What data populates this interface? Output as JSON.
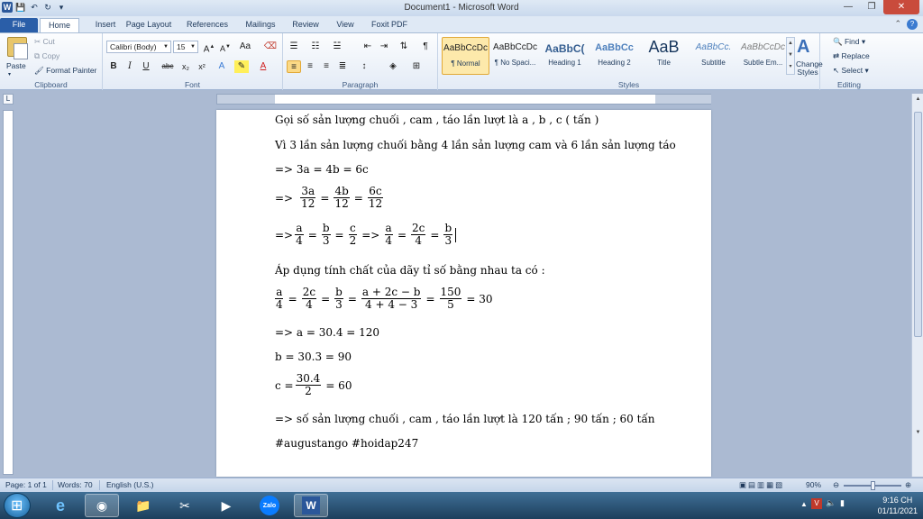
{
  "window": {
    "title": "Document1 - Microsoft Word",
    "min": "—",
    "max": "❐",
    "close": "✕"
  },
  "tabs": [
    "File",
    "Home",
    "Insert",
    "Page Layout",
    "References",
    "Mailings",
    "Review",
    "View",
    "Foxit PDF"
  ],
  "clipboard": {
    "label": "Clipboard",
    "paste": "Paste",
    "cut": "Cut",
    "copy": "Copy",
    "format_painter": "Format Painter"
  },
  "font": {
    "label": "Font",
    "name": "Calibri (Body)",
    "size": "15"
  },
  "paragraph": {
    "label": "Paragraph"
  },
  "styles": {
    "label": "Styles",
    "items": [
      {
        "preview": "AaBbCcDc",
        "name": "¶ Normal"
      },
      {
        "preview": "AaBbCcDc",
        "name": "¶ No Spaci..."
      },
      {
        "preview": "AaBbC(",
        "name": "Heading 1"
      },
      {
        "preview": "AaBbCc",
        "name": "Heading 2"
      },
      {
        "preview": "AaB",
        "name": "Title"
      },
      {
        "preview": "AaBbCc.",
        "name": "Subtitle"
      },
      {
        "preview": "AaBbCcDc",
        "name": "Subtle Em..."
      }
    ],
    "change_styles": "Change Styles"
  },
  "editing": {
    "label": "Editing",
    "find": "Find",
    "replace": "Replace",
    "select": "Select"
  },
  "document": {
    "line1": "Gọi số sản lượng chuối , cam , táo lần lượt là a , b , c ( tấn )",
    "line2": "Vì 3 lần sản lượng chuối bằng 4 lần sản lượng cam và 6 lần sản lượng táo",
    "line3": "=> 3a = 4b = 6c",
    "line4": {
      "prefix": "=>",
      "f1n": "3a",
      "f1d": "12",
      "f2n": "4b",
      "f2d": "12",
      "f3n": "6c",
      "f3d": "12"
    },
    "line5": {
      "prefix": "=>",
      "f1n": "a",
      "f1d": "4",
      "f2n": "b",
      "f2d": "3",
      "f3n": "c",
      "f3d": "2",
      "mid": "=>",
      "f4n": "a",
      "f4d": "4",
      "f5n": "2c",
      "f5d": "4",
      "f6n": "b",
      "f6d": "3"
    },
    "line6": "Áp dụng tính chất của dãy tỉ số bằng nhau ta có :",
    "line7": {
      "f1n": "a",
      "f1d": "4",
      "f2n": "2c",
      "f2d": "4",
      "f3n": "b",
      "f3d": "3",
      "f4n": "a + 2c − b",
      "f4d": "4 + 4 − 3",
      "f5n": "150",
      "f5d": "5",
      "result": "= 30"
    },
    "line8": "=> a = 30.4 = 120",
    "line9": "b = 30.3 = 90",
    "line10": {
      "prefix": "c =",
      "fn": "30.4",
      "fd": "2",
      "result": "= 60"
    },
    "line11": "=>  số sản lượng chuối , cam , táo lần lượt là 120 tấn ; 90 tấn ; 60 tấn",
    "line12": "#augustango #hoidap247"
  },
  "status": {
    "page": "Page: 1 of 1",
    "words": "Words: 70",
    "language": "English (U.S.)",
    "zoom": "90%"
  },
  "taskbar": {
    "time": "9:16 CH",
    "date": "01/11/2021",
    "zalo": "Zalo"
  }
}
